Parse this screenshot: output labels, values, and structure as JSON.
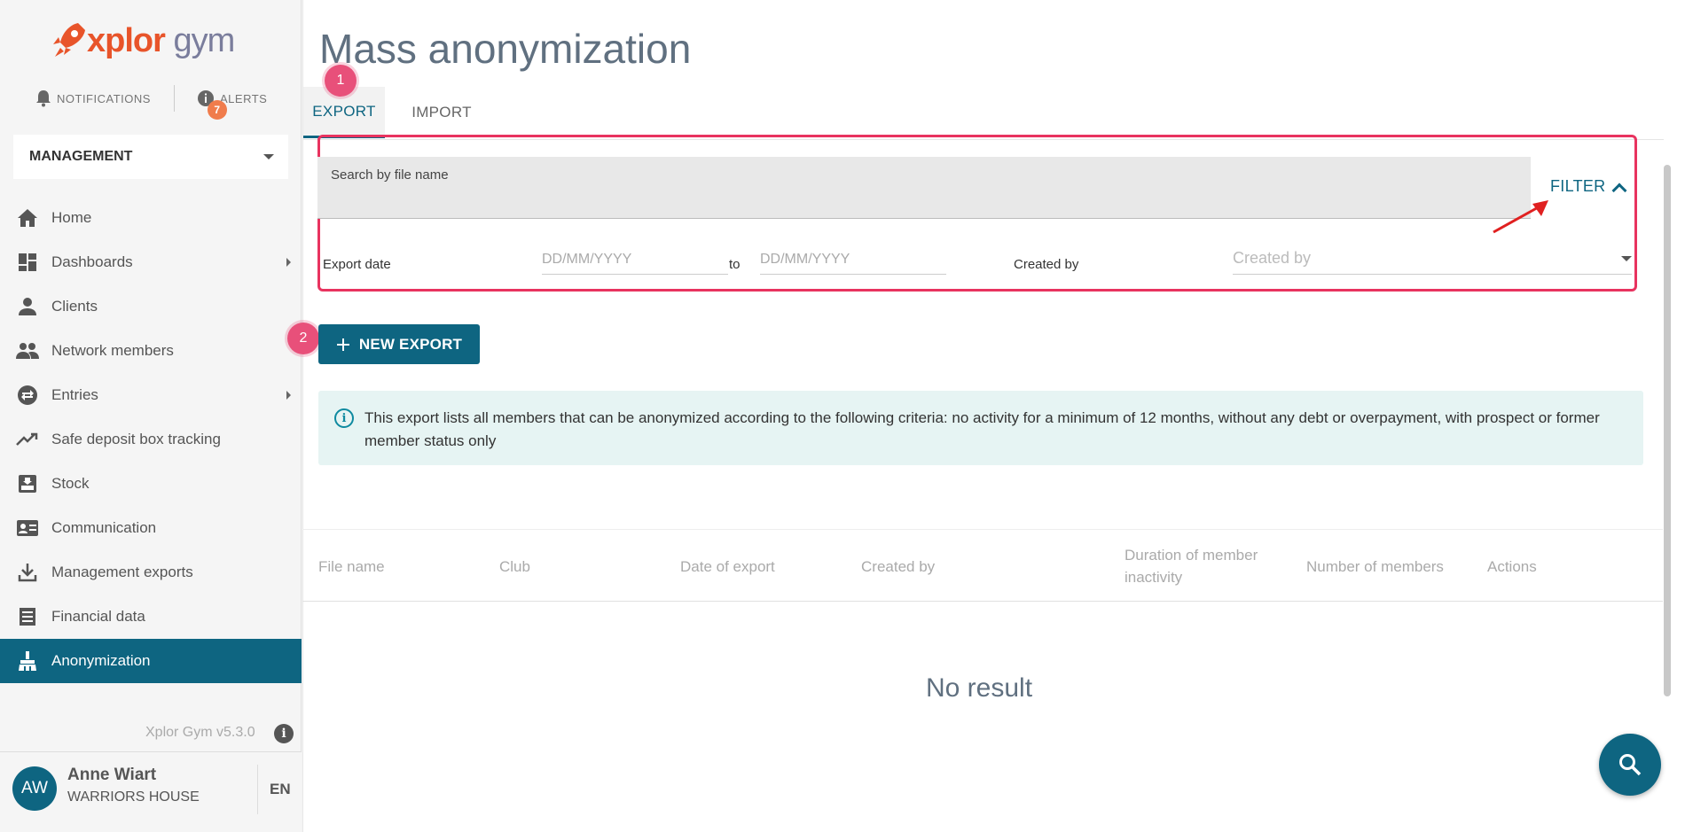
{
  "brand": {
    "logo_x": "x",
    "logo_rest": "plor",
    "logo_gym": " gym",
    "accent": "#e8542a",
    "primary": "#0e6581"
  },
  "topbar": {
    "notifications": "NOTIFICATIONS",
    "alerts": "ALERTS",
    "alerts_count": "7"
  },
  "sidebar": {
    "selector": "MANAGEMENT",
    "items": [
      {
        "label": "Home",
        "icon": "home-icon"
      },
      {
        "label": "Dashboards",
        "icon": "dashboard-icon"
      },
      {
        "label": "Clients",
        "icon": "person-icon"
      },
      {
        "label": "Network members",
        "icon": "group-icon"
      },
      {
        "label": "Entries",
        "icon": "swap-icon"
      },
      {
        "label": "Safe deposit box tracking",
        "icon": "trending-icon"
      },
      {
        "label": "Stock",
        "icon": "inbox-icon"
      },
      {
        "label": "Communication",
        "icon": "contact-card-icon"
      },
      {
        "label": "Management exports",
        "icon": "download-icon"
      },
      {
        "label": "Financial data",
        "icon": "receipt-icon"
      },
      {
        "label": "Anonymization",
        "icon": "broom-icon"
      }
    ],
    "version": "Xplor Gym v5.3.0"
  },
  "user": {
    "initials": "AW",
    "name": "Anne Wiart",
    "club": "WARRIORS HOUSE",
    "lang": "EN"
  },
  "page": {
    "title": "Mass anonymization"
  },
  "tabs": [
    {
      "label": "EXPORT"
    },
    {
      "label": "IMPORT"
    }
  ],
  "steps": {
    "one": "1",
    "two": "2"
  },
  "filters": {
    "search_label": "Search by file name",
    "toggle_label": "FILTER",
    "export_date_label": "Export date",
    "date_from_placeholder": "DD/MM/YYYY",
    "to_label": "to",
    "date_to_placeholder": "DD/MM/YYYY",
    "created_by_label": "Created by",
    "created_by_placeholder": "Created by"
  },
  "actions": {
    "new_export": "NEW EXPORT"
  },
  "info": {
    "text": "This export lists all members that can be anonymized according to the following criteria: no activity for a minimum of 12 months, without any debt or overpayment, with prospect or former member status only"
  },
  "table": {
    "columns": [
      "File name",
      "Club",
      "Date of export",
      "Created by",
      "Duration of member inactivity",
      "Number of members",
      "Actions"
    ],
    "empty": "No result"
  }
}
